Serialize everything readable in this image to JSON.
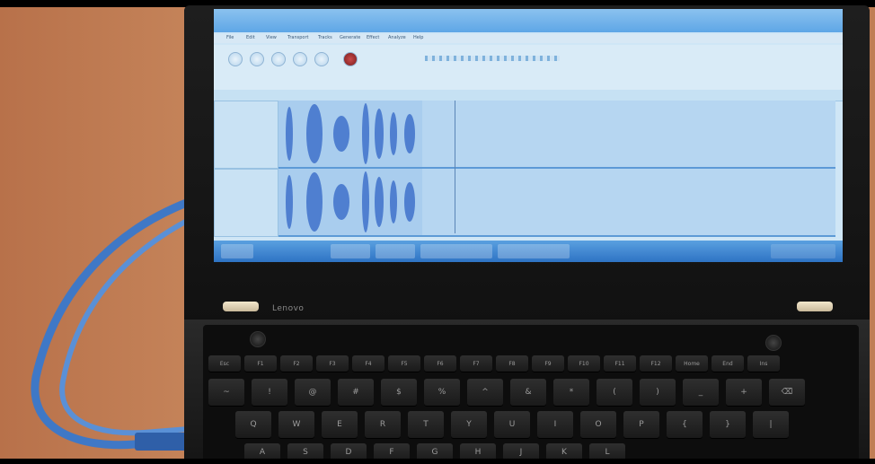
{
  "brand": "Lenovo",
  "app": {
    "menu_items": [
      "File",
      "Edit",
      "View",
      "Transport",
      "Tracks",
      "Generate",
      "Effect",
      "Analyze",
      "Help"
    ]
  },
  "keyboard": {
    "function_row": [
      "Esc",
      "F1",
      "F2",
      "F3",
      "F4",
      "F5",
      "F6",
      "F7",
      "F8",
      "F9",
      "F10",
      "F11",
      "F12",
      "Home",
      "End",
      "Ins"
    ],
    "number_row": [
      "~",
      "!",
      "@",
      "#",
      "$",
      "%",
      "^",
      "&",
      "*",
      "(",
      ")",
      "_",
      "+",
      "⌫"
    ],
    "qwerty_row": [
      "Q",
      "W",
      "E",
      "R",
      "T",
      "Y",
      "U",
      "I",
      "O",
      "P",
      "{",
      "}",
      "|"
    ],
    "home_row": [
      "A",
      "S",
      "D",
      "F",
      "G",
      "H",
      "J",
      "K",
      "L"
    ]
  },
  "colors": {
    "screen_bg": "#cfe6f6",
    "waveform": "#4f7fd0",
    "taskbar": "#2e73c4",
    "table": "#c07e55",
    "cable": "#3f78c6"
  }
}
